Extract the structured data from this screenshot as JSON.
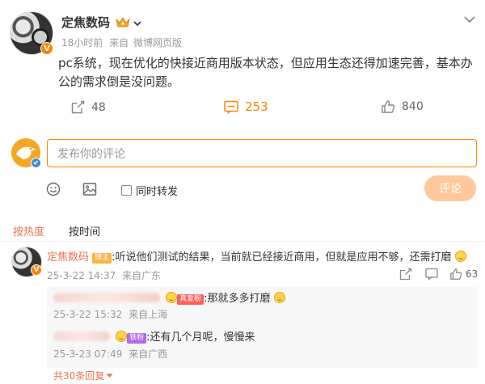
{
  "post": {
    "author": "定焦数码",
    "time": "18小时前",
    "source_prefix": "来自",
    "source": "微博网页版",
    "text": "pc系统，现在优化的快接近商用版本状态，但应用生态还得加速完善，基本办公的需求倒是没问题。",
    "reposts": "48",
    "comments": "253",
    "likes": "840",
    "verified_badge": "V"
  },
  "composer": {
    "placeholder": "发布你的评论",
    "repost_label": "同时转发",
    "submit_label": "评论"
  },
  "sort_tabs": [
    {
      "label": "按热度"
    },
    {
      "label": "按时间"
    }
  ],
  "comment": {
    "author": "定焦数码",
    "author_badge": "博主",
    "text": ":听说他们测试的结果，当前就已经接近商用，但就是应用不够，还需打磨",
    "time": "25-3-22 14:37",
    "location": "来自广东",
    "likes": "63",
    "replies": [
      {
        "badge": "真爱粉",
        "text": ":那就多多打磨",
        "time": "25-3-22 15:32",
        "location": "来自上海"
      },
      {
        "badge": "铁粉",
        "text": ":还有几个月呢，慢慢来",
        "time": "25-3-23 07:49",
        "location": "来自广西"
      }
    ],
    "more_replies": "共30条回复"
  },
  "colors": {
    "accent": "#ff8200",
    "link": "#eb7350",
    "submit_disabled": "#ffc89b"
  },
  "icons": [
    "chevron-down-icon",
    "crown-icon",
    "repost-icon",
    "comment-icon",
    "like-icon",
    "emoji-icon",
    "image-icon",
    "checkbox-icon",
    "share-icon",
    "reply-icon",
    "caret-down-icon"
  ]
}
